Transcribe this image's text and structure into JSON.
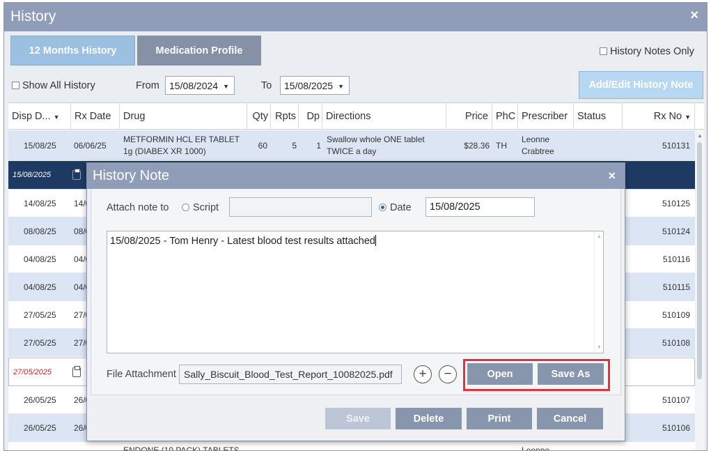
{
  "window": {
    "title": "History",
    "close_glyph": "×"
  },
  "tabs": [
    {
      "label": "12 Months History",
      "active": true
    },
    {
      "label": "Medication Profile",
      "active": false
    }
  ],
  "filters": {
    "history_notes_only": "History Notes Only",
    "show_all_history": "Show All History",
    "from_label": "From",
    "from_value": "15/08/2024",
    "to_label": "To",
    "to_value": "15/08/2025",
    "add_edit_button": "Add/Edit History Note"
  },
  "grid": {
    "columns": [
      "Disp D...",
      "Rx Date",
      "Drug",
      "Qty",
      "Rpts",
      "Dp",
      "Directions",
      "Price",
      "PhC",
      "Prescriber",
      "Status",
      "Rx No"
    ],
    "rows": [
      {
        "disp": "15/08/25",
        "rxdate": "06/06/25",
        "drug": "METFORMIN HCL ER TABLET 1g (DIABEX XR 1000)",
        "qty": "60",
        "rpts": "5",
        "dp": "1",
        "directions": "Swallow whole ONE tablet TWICE a day",
        "price": "$28.36",
        "phc": "TH",
        "prescriber": "Leonne Crabtree",
        "rxno": "510131",
        "style": "alt"
      },
      {
        "disp": "15/08/2025",
        "rxdate": "",
        "drug": "",
        "qty": "",
        "rpts": "",
        "dp": "",
        "directions": "",
        "price": "",
        "phc": "",
        "prescriber": "",
        "rxno": "",
        "style": "sel"
      },
      {
        "disp": "14/08/25",
        "rxdate": "14/0",
        "rxno": "510125",
        "style": "plain"
      },
      {
        "disp": "08/08/25",
        "rxdate": "08/0",
        "rxno": "510124",
        "style": "alt"
      },
      {
        "disp": "04/08/25",
        "rxdate": "04/0",
        "rxno": "510116",
        "style": "plain"
      },
      {
        "disp": "04/08/25",
        "rxdate": "04/0",
        "rxno": "510115",
        "style": "alt"
      },
      {
        "disp": "27/05/25",
        "rxdate": "27/0",
        "rxno": "510109",
        "style": "plain"
      },
      {
        "disp": "27/05/25",
        "rxdate": "27/0",
        "rxno": "510108",
        "style": "alt"
      },
      {
        "disp": "27/05/2025",
        "rxdate": "",
        "rxno": "",
        "style": "note"
      },
      {
        "disp": "26/05/25",
        "rxdate": "26/0",
        "rxno": "510107",
        "style": "plain"
      },
      {
        "disp": "26/05/25",
        "rxdate": "26/0",
        "rxno": "510106",
        "style": "alt"
      },
      {
        "disp": "",
        "rxdate": "",
        "drug": "ENDONE (10 PACK) TABLETS",
        "prescriber": "Leonne",
        "rxno": "",
        "style": "plain"
      }
    ]
  },
  "modal": {
    "title": "History Note",
    "close_glyph": "×",
    "attach_label": "Attach note to",
    "script_label": "Script",
    "script_value": "",
    "date_label": "Date",
    "date_value": "15/08/2025",
    "note_text": "15/08/2025 - Tom Henry - Latest blood test results attached",
    "file_label": "File Attachment",
    "file_value": "Sally_Biscuit_Blood_Test_Report_10082025.pdf",
    "add_glyph": "+",
    "remove_glyph": "−",
    "open_button": "Open",
    "save_as_button": "Save As",
    "save_button": "Save",
    "delete_button": "Delete",
    "print_button": "Print",
    "cancel_button": "Cancel"
  },
  "colors": {
    "titlebar": "#8f9db8",
    "selected_row": "#1f3a62",
    "alt_row": "#dbe5f3",
    "highlight": "#e0323c"
  }
}
